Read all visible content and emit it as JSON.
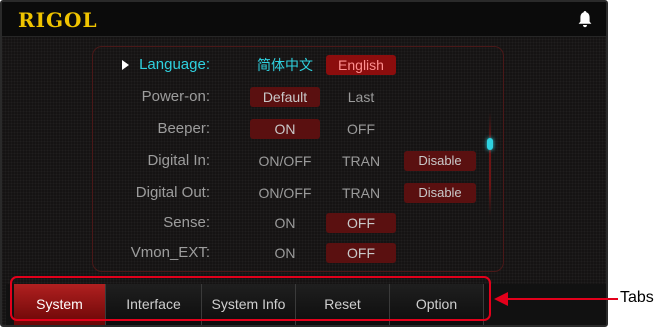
{
  "brand": "RIGOL",
  "settings": {
    "language": {
      "label": "Language:",
      "options": [
        "简体中文",
        "English"
      ],
      "selected": "English"
    },
    "power_on": {
      "label": "Power-on:",
      "options": [
        "Default",
        "Last"
      ],
      "selected": "Default"
    },
    "beeper": {
      "label": "Beeper:",
      "options": [
        "ON",
        "OFF"
      ],
      "selected": "ON"
    },
    "digital_in": {
      "label": "Digital In:",
      "options": [
        "ON/OFF",
        "TRAN"
      ],
      "button": "Disable"
    },
    "digital_out": {
      "label": "Digital Out:",
      "options": [
        "ON/OFF",
        "TRAN"
      ],
      "button": "Disable"
    },
    "sense": {
      "label": "Sense:",
      "options": [
        "ON",
        "OFF"
      ],
      "selected": "OFF"
    },
    "vmon_ext": {
      "label": "Vmon_EXT:",
      "options": [
        "ON",
        "OFF"
      ],
      "selected": "OFF"
    }
  },
  "tabs": [
    {
      "label": "System",
      "active": true
    },
    {
      "label": "Interface",
      "active": false
    },
    {
      "label": "System Info",
      "active": false
    },
    {
      "label": "Reset",
      "active": false
    },
    {
      "label": "Option",
      "active": false
    }
  ],
  "annotation": {
    "label": "Tabs",
    "color": "#e3001b"
  },
  "colors": {
    "brand": "#f0c400",
    "focus": "#2fd2e0",
    "selected_bg": "#5a1010",
    "active_tab": "#b02020"
  },
  "icons": {
    "notification": "bell-icon",
    "focus_marker": "triangle-right-icon"
  }
}
